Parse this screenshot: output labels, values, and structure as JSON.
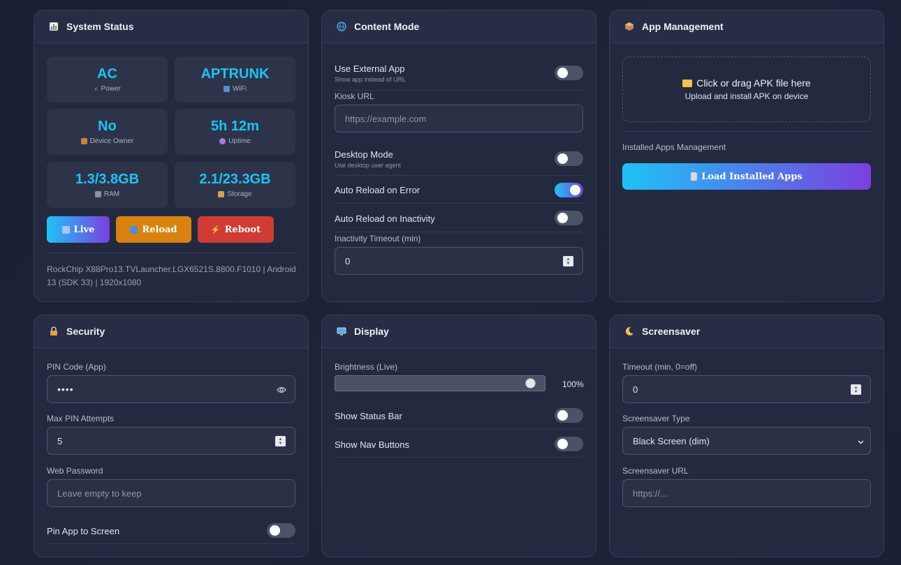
{
  "system_status": {
    "title": "System Status",
    "tiles": [
      {
        "value": "AC",
        "label": "Power",
        "icon": "bolt-icon"
      },
      {
        "value": "APTRUNK",
        "label": "WiFi",
        "icon": "wifi-icon"
      },
      {
        "value": "No",
        "label": "Device Owner",
        "icon": "lock-icon"
      },
      {
        "value": "5h 12m",
        "label": "Uptime",
        "icon": "clock-icon"
      },
      {
        "value": "1.3/3.8GB",
        "label": "RAM",
        "icon": "memory-icon"
      },
      {
        "value": "2.1/23.3GB",
        "label": "Storage",
        "icon": "folder-icon"
      }
    ],
    "buttons": {
      "live": "Live",
      "reload": "Reload",
      "reboot": "Reboot"
    },
    "device_info": "RockChip X88Pro13.TVLauncher.LGX6521S.8800.F1010 | Android 13 (SDK 33) | 1920x1080"
  },
  "content_mode": {
    "title": "Content Mode",
    "use_external_app": {
      "label": "Use External App",
      "sub": "Show app instead of URL",
      "on": false
    },
    "kiosk_url": {
      "label": "Kiosk URL",
      "placeholder": "https://example.com"
    },
    "desktop_mode": {
      "label": "Desktop Mode",
      "sub": "Use desktop user agent",
      "on": false
    },
    "auto_reload_error": {
      "label": "Auto Reload on Error",
      "on": true
    },
    "auto_reload_inactivity": {
      "label": "Auto Reload on Inactivity",
      "on": false
    },
    "inactivity_timeout": {
      "label": "Inactivity Timeout (min)",
      "value": "0"
    }
  },
  "app_management": {
    "title": "App Management",
    "dropzone_title": "Click or drag APK file here",
    "dropzone_sub": "Upload and install APK on device",
    "installed_label": "Installed Apps Management",
    "load_button": "Load Installed Apps"
  },
  "security": {
    "title": "Security",
    "pin_label": "PIN Code (App)",
    "pin_value": "••••",
    "max_attempts_label": "Max PIN Attempts",
    "max_attempts_value": "5",
    "web_password_label": "Web Password",
    "web_password_placeholder": "Leave empty to keep",
    "pin_app_label": "Pin App to Screen",
    "pin_app_on": false
  },
  "display": {
    "title": "Display",
    "brightness_label": "Brightness (Live)",
    "brightness_value": "100%",
    "brightness_fraction": 1.0,
    "show_status_bar": "Show Status Bar",
    "show_nav_buttons": "Show Nav Buttons"
  },
  "screensaver": {
    "title": "Screensaver",
    "timeout_label": "Timeout (min, 0=off)",
    "timeout_value": "0",
    "type_label": "Screensaver Type",
    "type_value": "Black Screen (dim)",
    "url_label": "Screensaver URL",
    "url_placeholder": "https://..."
  },
  "colors": {
    "accent_cyan": "#1ec3f5",
    "accent_purple": "#7b3fe0",
    "reload_orange": "#d9820f",
    "reboot_red": "#cf3b35"
  }
}
